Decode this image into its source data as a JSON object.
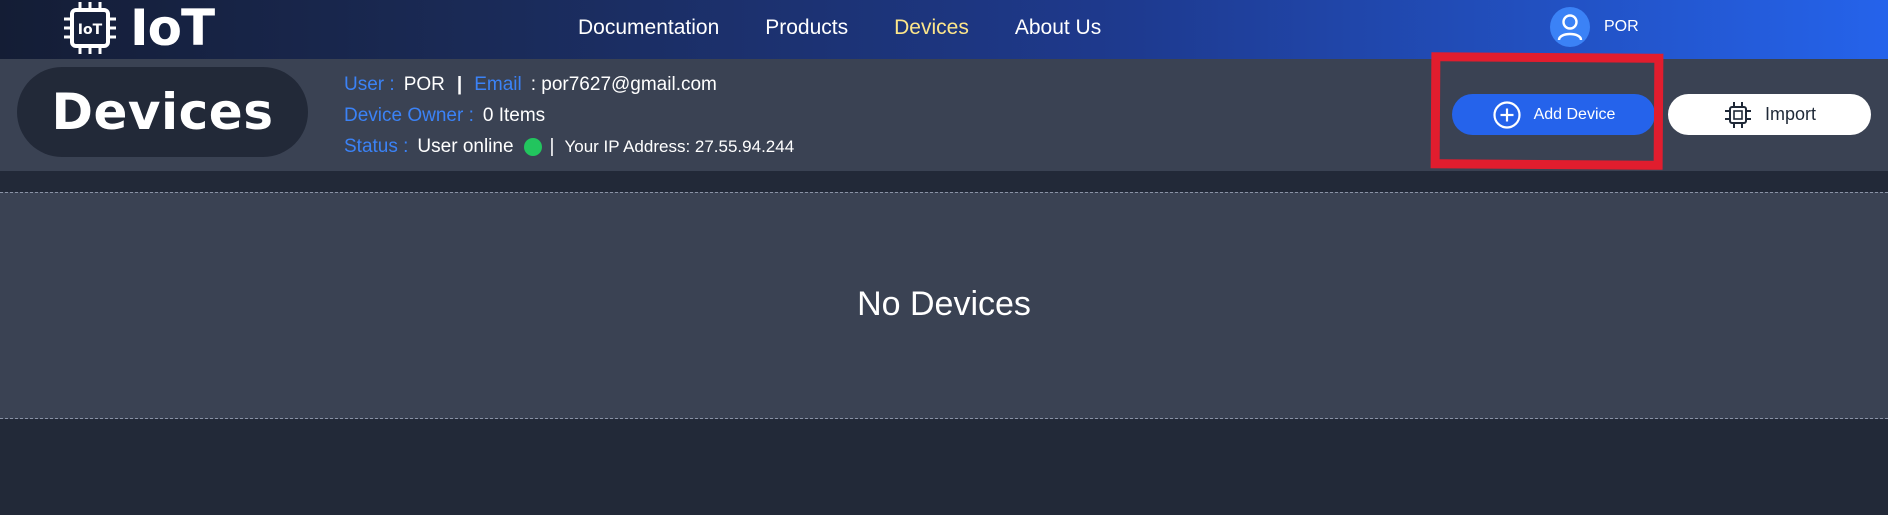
{
  "nav": {
    "logo_text": "IoT",
    "logo_chip_text": "IoT",
    "links": [
      "Documentation",
      "Products",
      "Devices",
      "About Us"
    ],
    "active_link": "Devices",
    "user": "POR"
  },
  "header": {
    "title": "Devices",
    "user_label": "User :",
    "user_value": "POR",
    "separator": "|",
    "email_label": "Email",
    "email_value": ": por7627@gmail.com",
    "owner_label": "Device Owner :",
    "owner_value": "0 Items",
    "status_label": "Status :",
    "status_value": "User online",
    "ip_separator": "|",
    "ip_text": "Your IP Address: 27.55.94.244"
  },
  "buttons": {
    "add_label": "Add Device",
    "import_label": "Import"
  },
  "main": {
    "empty_text": "No Devices"
  },
  "colors": {
    "accent": "#2563eb",
    "label_blue": "#3b82f6",
    "active_nav": "#fde68a",
    "online": "#22c55e",
    "highlight": "#e11d2e",
    "panel": "#3a4253",
    "background": "#222938"
  }
}
